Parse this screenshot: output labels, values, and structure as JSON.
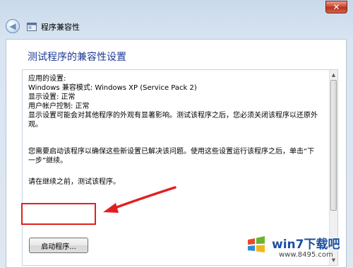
{
  "window": {
    "title": "程序兼容性",
    "close_label": "✕",
    "back_label": "◀"
  },
  "content": {
    "heading": "测试程序的兼容性设置",
    "lines": [
      "应用的设置:",
      "Windows 兼容模式: Windows XP (Service Pack 2)",
      "显示设置: 正常",
      "用户帐户控制: 正常",
      "显示设置可能会对其他程序的外观有显著影响。测试该程序之后，您必须关闭该程序以还原外",
      "观。",
      "您需要启动该程序以确保这些新设置已解决该问题。使用这些设置运行该程序之后，单击“下",
      "一步”继续。",
      "请在继续之前，测试该程序。"
    ],
    "launch_button_label": "启动程序..."
  },
  "watermark": {
    "main": "win7下载吧",
    "url": "www.8495.com"
  },
  "colors": {
    "heading": "#1f3a93",
    "highlight": "#e02020",
    "titlebar": "#c9d9ea"
  }
}
